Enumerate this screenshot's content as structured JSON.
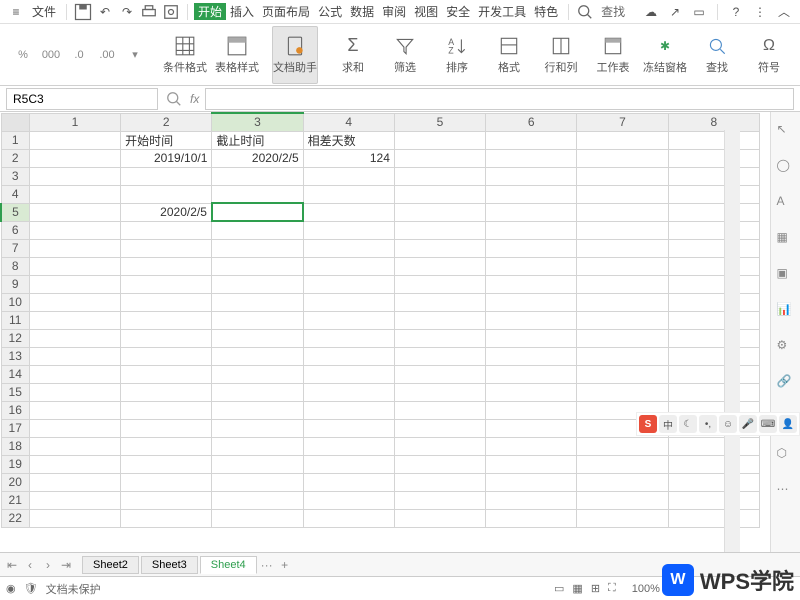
{
  "topbar": {
    "file_label": "文件",
    "menus": [
      "开始",
      "插入",
      "页面布局",
      "公式",
      "数据",
      "审阅",
      "视图",
      "安全",
      "开发工具",
      "特色"
    ],
    "active_menu": 0,
    "search_label": "查找"
  },
  "ribbon": {
    "cond_format": "条件格式",
    "table_style": "表格样式",
    "doc_assist": "文档助手",
    "sum": "求和",
    "filter": "筛选",
    "sort": "排序",
    "format": "格式",
    "row_col": "行和列",
    "worksheet": "工作表",
    "freeze": "冻结窗格",
    "find": "查找",
    "symbol": "符号"
  },
  "small_tools": {
    "percent": "%",
    "thousands": "000",
    "dec_inc": ".0←",
    "dec_dec": "→.0",
    "type": "类型"
  },
  "formula_bar": {
    "cell_ref": "R5C3",
    "fx": "fx",
    "value": ""
  },
  "columns": [
    "1",
    "2",
    "3",
    "4",
    "5",
    "6",
    "7",
    "8"
  ],
  "rows": 22,
  "active_cell": {
    "row": 5,
    "col": 3
  },
  "cells": {
    "1": {
      "2": "开始时间",
      "3": "截止时间",
      "4": "相差天数"
    },
    "2": {
      "2": "2019/10/1",
      "3": "2020/2/5",
      "4": "124"
    },
    "5": {
      "2": "2020/2/5"
    }
  },
  "cell_align": {
    "1": {
      "2": "left",
      "3": "left",
      "4": "left"
    }
  },
  "sheet_tabs": {
    "tabs": [
      "Sheet2",
      "Sheet3",
      "Sheet4"
    ],
    "active": 2,
    "more": "···",
    "add": "+"
  },
  "status": {
    "protect": "文档未保护",
    "zoom": "100%"
  },
  "brand": {
    "logo": "W",
    "text": "WPS学院"
  },
  "ime": {
    "sogou": "S",
    "zh": "中"
  }
}
